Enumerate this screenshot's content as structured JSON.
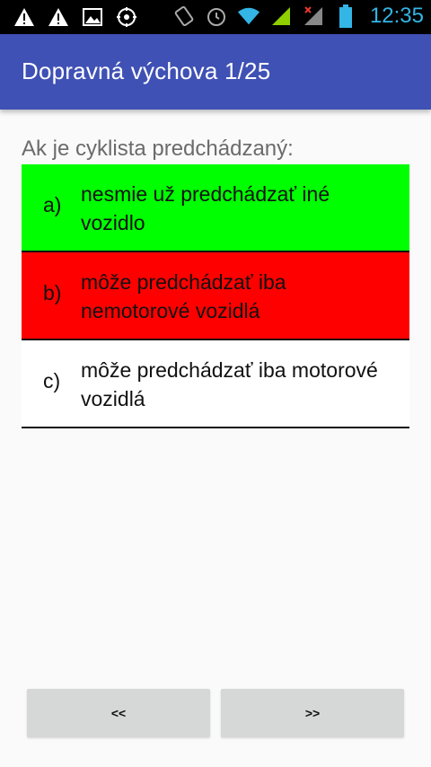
{
  "status_bar": {
    "time": "12:35",
    "icons": [
      "warning-icon",
      "warning-icon",
      "image-icon",
      "settings-sync-icon",
      "screen-rotation-icon",
      "alarm-icon",
      "wifi-icon",
      "signal-icon",
      "signal-no-data-icon",
      "battery-icon"
    ]
  },
  "app_bar": {
    "title": "Dopravná výchova 1/25"
  },
  "question": {
    "text": "Ak je cyklista predchádzaný:"
  },
  "answers": [
    {
      "letter": "a)",
      "text": "nesmie už predchádzať iné vozidlo",
      "bg": "#00ff00"
    },
    {
      "letter": "b)",
      "text": "môže predchádzať iba nemotorové vozidlá",
      "bg": "#ff0000"
    },
    {
      "letter": "c)",
      "text": "môže predchádzať iba motorové vozidlá",
      "bg": "#ffffff"
    }
  ],
  "nav": {
    "prev_label": "<<",
    "next_label": ">>"
  },
  "colors": {
    "app_bar": "#3f51b5",
    "correct": "#00ff00",
    "wrong": "#ff0000",
    "clock": "#33b5e5"
  }
}
